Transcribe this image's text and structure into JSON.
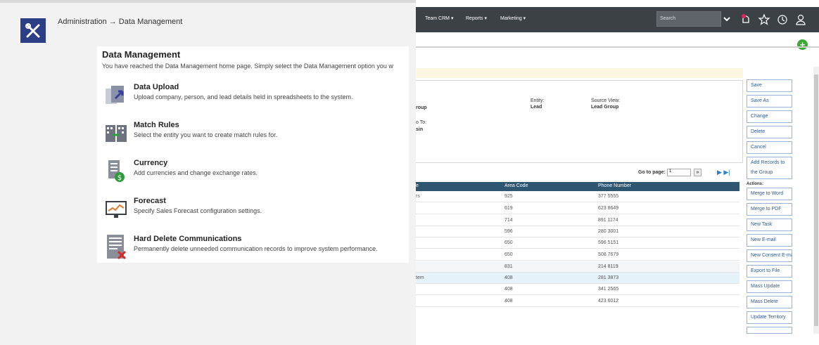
{
  "left_panel": {
    "breadcrumb": "Administration → Data Management",
    "card": {
      "title": "Data Management",
      "subtitle": "You have reached the Data Management home page. Simply select the Data Management option you w",
      "items": [
        {
          "label": "Data Upload",
          "desc": "Upload company, person, and lead details held in spreadsheets to the system.",
          "icon": "upload-icon"
        },
        {
          "label": "Match Rules",
          "desc": "Select the entity you want to create match rules for.",
          "icon": "match-rules-icon"
        },
        {
          "label": "Currency",
          "desc": "Add currencies and change exchange rates.",
          "icon": "currency-icon"
        },
        {
          "label": "Forecast",
          "desc": "Specify Sales Forecast configuration settings.",
          "icon": "forecast-icon"
        },
        {
          "label": "Hard Delete Communications",
          "desc": "Permanently delete unneeded communication records to improve system performance.",
          "icon": "hard-delete-icon"
        }
      ]
    }
  },
  "right_panel": {
    "nav": {
      "items": [
        "Team CRM ▾",
        "Reports ▾",
        "Marketing ▾"
      ],
      "search_placeholder": "Search"
    },
    "info": {
      "group_fragment": "roup",
      "to_fragment": "o To:",
      "sin_fragment": "sin",
      "entity_label": "Entity:",
      "entity_value": "Lead",
      "source_label": "Source View:",
      "source_value": "Lead Group"
    },
    "pagination": {
      "label": "Go to page:",
      "value": "1",
      "go": "»",
      "arrows": "▶ ▶|"
    },
    "table": {
      "headers": [
        "e",
        "Area Code",
        "Phone Number"
      ],
      "rows": [
        [
          "rs",
          "925",
          "377 5555"
        ],
        [
          "",
          "619",
          "623 8649"
        ],
        [
          "",
          "714",
          "891 1174"
        ],
        [
          "",
          "596",
          "280 3001"
        ],
        [
          "",
          "650",
          "596 5151"
        ],
        [
          "",
          "650",
          "508 7679"
        ],
        [
          "",
          "831",
          "214 8119"
        ],
        [
          "tem",
          "408",
          "281 3873"
        ],
        [
          "",
          "408",
          "341 2565"
        ],
        [
          "",
          "408",
          "423 6012"
        ]
      ]
    },
    "actions": {
      "top": [
        "Save",
        "Save As",
        "Change",
        "Delete",
        "Cancel",
        "Add Records to the Group"
      ],
      "label": "Actions:",
      "bottom": [
        "Merge to Word",
        "Merge to PDF",
        "New Task",
        "New E-mail",
        "New Consent E-mail",
        "Export to File",
        "Mass Update",
        "Mass Delete",
        "Update Territory",
        "…"
      ]
    },
    "colors": {
      "nav_bg": "#3c4146",
      "table_head": "#2e5670",
      "plus": "#3aaa35",
      "link": "#2e5b93"
    }
  }
}
